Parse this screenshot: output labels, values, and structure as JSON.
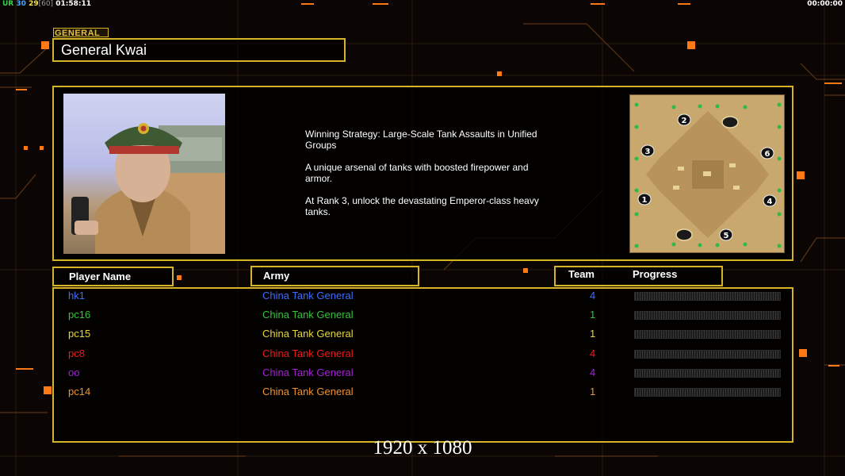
{
  "hud": {
    "top_left": {
      "ur": "UR",
      "v1": "30",
      "v2": "29",
      "v3": "[60]",
      "time": "01:58:11"
    },
    "top_right": "00:00:00"
  },
  "section_label": "GENERAL",
  "general_name": "General Kwai",
  "description": [
    "Winning Strategy: Large-Scale Tank Assaults in Unified\n Groups",
    "A unique arsenal of tanks with boosted firepower and\n armor.",
    "At Rank 3, unlock the devastating Emperor-class heavy\n tanks."
  ],
  "minimap": {
    "start_positions": [
      "1",
      "2",
      "3",
      "4",
      "5",
      "6"
    ]
  },
  "table": {
    "headers": {
      "player": "Player Name",
      "army": "Army",
      "team": "Team",
      "progress": "Progress"
    },
    "rows": [
      {
        "name": "hk1",
        "army": "China Tank General",
        "team": "4",
        "color": "#3f6cff",
        "progress": 0
      },
      {
        "name": "pc16",
        "army": "China Tank General",
        "team": "1",
        "color": "#33c43a",
        "progress": 0
      },
      {
        "name": "pc15",
        "army": "China Tank General",
        "team": "1",
        "color": "#e6d83a",
        "progress": 0
      },
      {
        "name": "pc8",
        "army": "China Tank General",
        "team": "4",
        "color": "#ee1c1c",
        "progress": 0
      },
      {
        "name": "oo",
        "army": "China Tank General",
        "team": "4",
        "color": "#a322d6",
        "progress": 0
      },
      {
        "name": "pc14",
        "army": "China Tank General",
        "team": "1",
        "color": "#f0922e",
        "progress": 0
      }
    ]
  },
  "resolution_label": "1920 x 1080",
  "colors": {
    "accent": "#d7b427",
    "highlight": "#ff7a14"
  }
}
